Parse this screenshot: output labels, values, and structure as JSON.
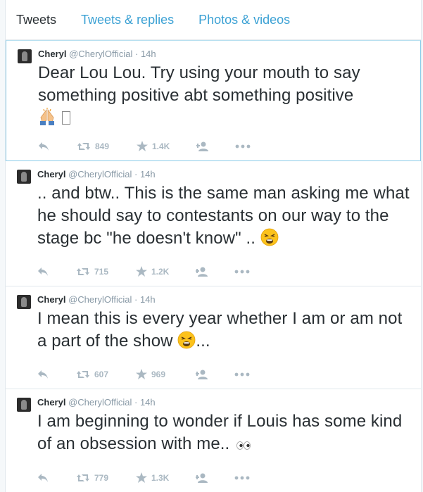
{
  "tabs": [
    {
      "label": "Tweets",
      "active": true
    },
    {
      "label": "Tweets & replies",
      "active": false
    },
    {
      "label": "Photos & videos",
      "active": false
    }
  ],
  "colors": {
    "link": "#3ba1d4",
    "muted": "#8899a6",
    "icon": "#aab8c2"
  },
  "tweets": [
    {
      "name": "Cheryl",
      "handle": "@CherylOfficial",
      "sep": "·",
      "time": "14h",
      "text": "Dear Lou Lou. Try using your mouth to say something positive abt something positive",
      "emoji": [
        "praying-hands-icon",
        "missing-glyph-box"
      ],
      "emoji_suffix": "",
      "retweets": "849",
      "favorites": "1.4K"
    },
    {
      "name": "Cheryl",
      "handle": "@CherylOfficial",
      "sep": "·",
      "time": "14h",
      "text": ".. and btw.. This is the same man asking me what he should say to contestants on our way to the stage bc \"he doesn't know\" ..",
      "emoji": [
        "weary-face-icon"
      ],
      "emoji_suffix": "",
      "retweets": "715",
      "favorites": "1.2K"
    },
    {
      "name": "Cheryl",
      "handle": "@CherylOfficial",
      "sep": "·",
      "time": "14h",
      "text": "I mean this is every year whether I am or am not a part of the show",
      "emoji": [
        "weary-face-icon"
      ],
      "emoji_suffix": "...",
      "retweets": "607",
      "favorites": "969"
    },
    {
      "name": "Cheryl",
      "handle": "@CherylOfficial",
      "sep": "·",
      "time": "14h",
      "text": "I am beginning to wonder if Louis has some kind of an obsession with me..",
      "emoji": [
        "eyes-icon"
      ],
      "emoji_suffix": "",
      "retweets": "779",
      "favorites": "1.3K"
    }
  ]
}
